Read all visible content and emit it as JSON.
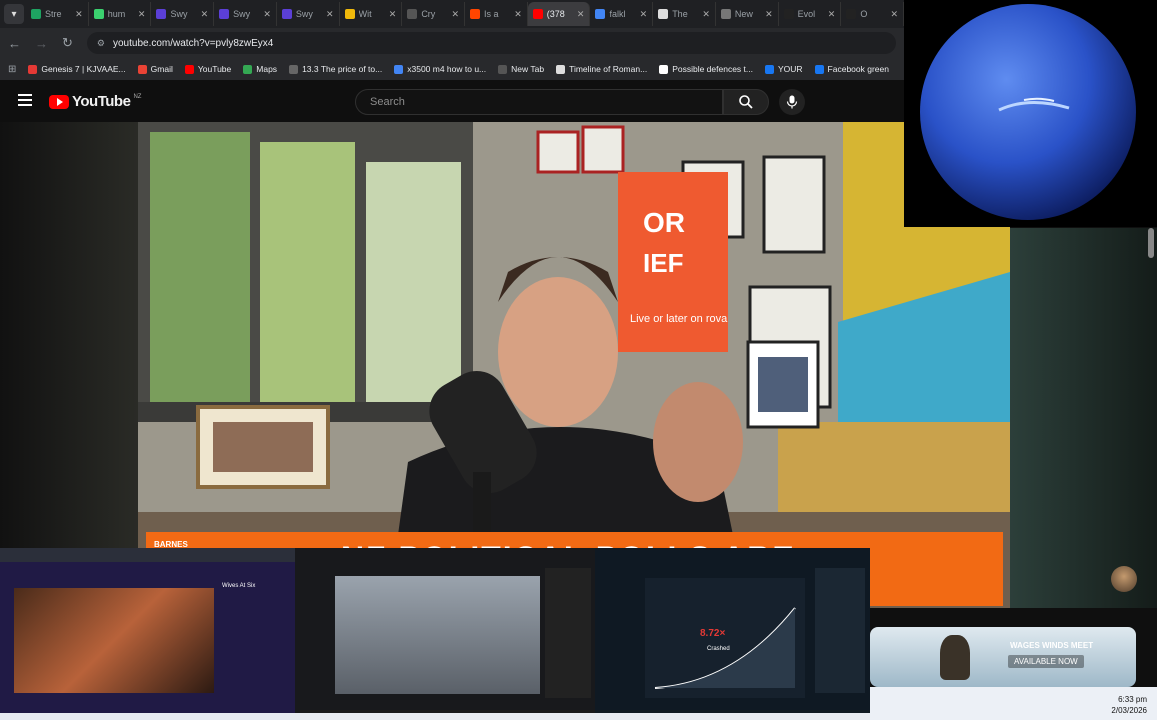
{
  "browser": {
    "tabs": [
      {
        "label": "Stre",
        "color": "#1ea362",
        "active": false
      },
      {
        "label": "hum",
        "color": "#3bd16f",
        "active": false
      },
      {
        "label": "Swy",
        "color": "#5b3fd6",
        "active": false
      },
      {
        "label": "Swy",
        "color": "#5b3fd6",
        "active": false
      },
      {
        "label": "Swy",
        "color": "#5b3fd6",
        "active": false
      },
      {
        "label": "Wit",
        "color": "#f0b90b",
        "active": false
      },
      {
        "label": "Cry",
        "color": "#555555",
        "active": false
      },
      {
        "label": "Is a",
        "color": "#ff4500",
        "active": false
      },
      {
        "label": "(378",
        "color": "#ff0000",
        "active": true
      },
      {
        "label": "falkl",
        "color": "#4285f4",
        "active": false
      },
      {
        "label": "The",
        "color": "#dddddd",
        "active": false
      },
      {
        "label": "New",
        "color": "#777777",
        "active": false
      },
      {
        "label": "Evol",
        "color": "#222222",
        "active": false
      },
      {
        "label": "O",
        "color": "#222222",
        "active": false
      }
    ],
    "url": "youtube.com/watch?v=pvly8zwEyx4",
    "bookmarks": [
      {
        "label": "Genesis 7 | KJVAAE...",
        "color": "#e53935"
      },
      {
        "label": "Gmail",
        "color": "#ea4335"
      },
      {
        "label": "YouTube",
        "color": "#ff0000"
      },
      {
        "label": "Maps",
        "color": "#34a853"
      },
      {
        "label": "13.3 The price of to...",
        "color": "#666666"
      },
      {
        "label": "x3500 m4 how to u...",
        "color": "#4285f4"
      },
      {
        "label": "New Tab",
        "color": "#555555"
      },
      {
        "label": "Timeline of Roman...",
        "color": "#dddddd"
      },
      {
        "label": "Possible defences t...",
        "color": "#ffffff"
      },
      {
        "label": "YOUR",
        "color": "#1877f2"
      },
      {
        "label": "Facebook green",
        "color": "#1877f2"
      }
    ]
  },
  "youtube": {
    "logo_text": "YouTube",
    "country_code": "NZ",
    "search_placeholder": "Search"
  },
  "video": {
    "lower_third_small": "BARNES",
    "lower_third_headline": "NZ POLITICAL POLLS ARE",
    "sign_banner": "Live or later on rova",
    "sign_top": "OR",
    "sign_bottom": "IEF"
  },
  "bottom_windows": {
    "panel1_title": "Wives At Six",
    "chart_badge": "8.72×",
    "chart_status": "Crashed"
  },
  "ad": {
    "title": "WAGES WINDS MEET",
    "cta": "AVAILABLE NOW"
  },
  "taskbar": {
    "time": "6:33 pm",
    "date": "2/03/2026"
  },
  "colors": {
    "accent": "#ff0000",
    "banner": "#f26a14"
  }
}
